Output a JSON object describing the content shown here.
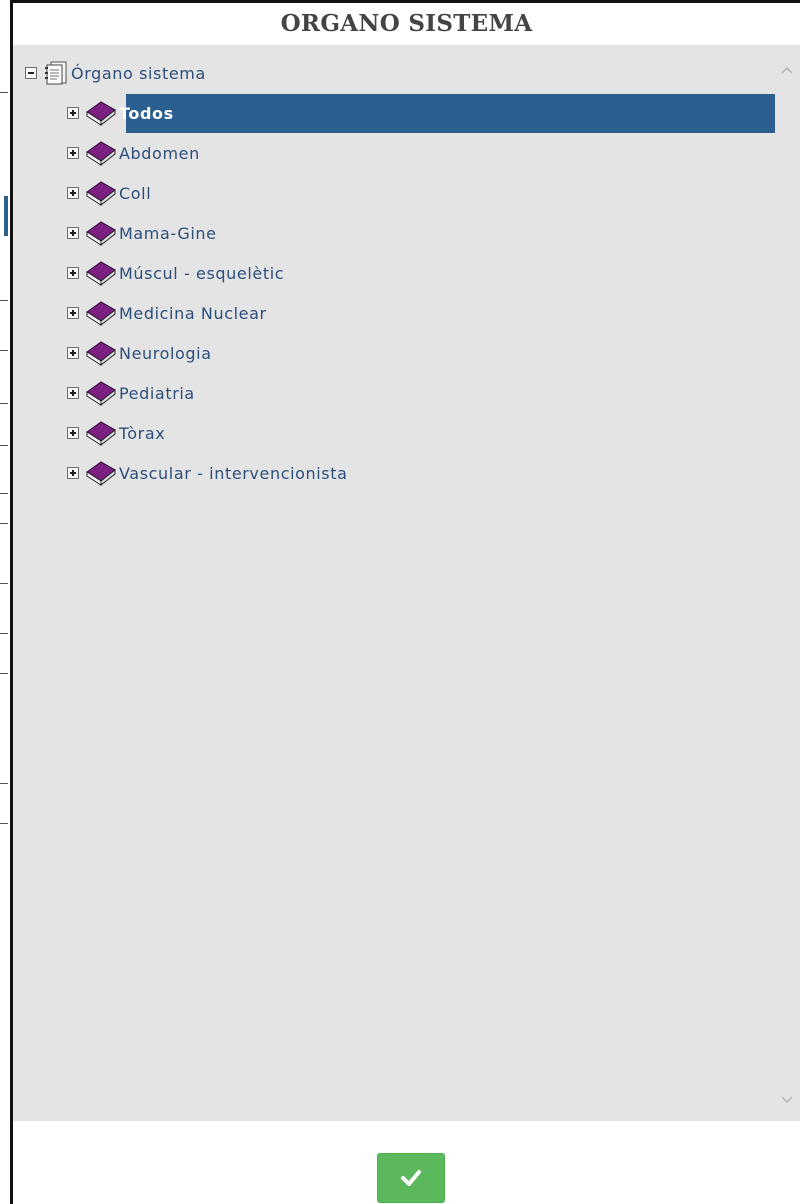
{
  "dialog": {
    "title": "ORGANO SISTEMA"
  },
  "tree": {
    "root": {
      "label": "Órgano sistema",
      "icon": "folder-icon",
      "expanded": true
    },
    "items": [
      {
        "label": "Todos",
        "selected": true,
        "icon": "book-icon"
      },
      {
        "label": "Abdomen",
        "icon": "book-icon"
      },
      {
        "label": "Coll",
        "icon": "book-icon"
      },
      {
        "label": "Mama-Gine",
        "icon": "book-icon"
      },
      {
        "label": "Múscul - esquelètic",
        "icon": "book-icon"
      },
      {
        "label": "Medicina Nuclear",
        "icon": "book-icon"
      },
      {
        "label": "Neurologia",
        "icon": "book-icon"
      },
      {
        "label": "Pediatria",
        "icon": "book-icon"
      },
      {
        "label": "Tòrax",
        "icon": "book-icon"
      },
      {
        "label": "Vascular - intervencionista",
        "icon": "book-icon"
      }
    ]
  },
  "scrollbar": {
    "left_arrow": "<",
    "right_arrow": ">"
  },
  "confirm_button": {
    "icon": "check-icon",
    "color": "#5cb85c"
  },
  "colors": {
    "selection": "#2a5f8f",
    "label": "#2d4f7c",
    "book": "#7b1f83",
    "panel": "#e4e4e4"
  }
}
